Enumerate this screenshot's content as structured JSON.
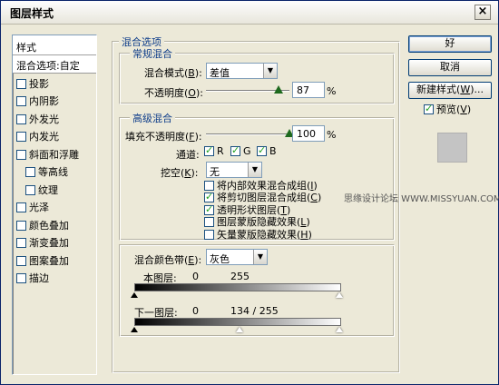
{
  "window": {
    "title": "图层样式",
    "close_label": "×"
  },
  "stylelist": {
    "header": "样式",
    "items": [
      {
        "label": "混合选项:自定",
        "checkbox": false,
        "checked": false,
        "selected": true
      },
      {
        "label": "投影",
        "checkbox": true,
        "checked": false
      },
      {
        "label": "内阴影",
        "checkbox": true,
        "checked": false
      },
      {
        "label": "外发光",
        "checkbox": true,
        "checked": false
      },
      {
        "label": "内发光",
        "checkbox": true,
        "checked": false
      },
      {
        "label": "斜面和浮雕",
        "checkbox": true,
        "checked": false
      },
      {
        "label": "等高线",
        "checkbox": true,
        "checked": false,
        "indent": true
      },
      {
        "label": "纹理",
        "checkbox": true,
        "checked": false,
        "indent": true
      },
      {
        "label": "光泽",
        "checkbox": true,
        "checked": false
      },
      {
        "label": "颜色叠加",
        "checkbox": true,
        "checked": false
      },
      {
        "label": "渐变叠加",
        "checkbox": true,
        "checked": false
      },
      {
        "label": "图案叠加",
        "checkbox": true,
        "checked": false
      },
      {
        "label": "描边",
        "checkbox": true,
        "checked": false
      }
    ]
  },
  "blending": {
    "title": "混合选项",
    "general": {
      "title": "常规混合",
      "mode_label": "混合模式(",
      "mode_key": "B",
      "mode_close": "):",
      "mode_value": "差值",
      "opacity_label": "不透明度(",
      "opacity_key": "O",
      "opacity_close": "):",
      "opacity_value": "87",
      "opacity_level": 0.87,
      "percent": "%"
    },
    "advanced": {
      "title": "高级混合",
      "fill_label": "填充不透明度(",
      "fill_key": "F",
      "fill_close": "):",
      "fill_value": "100",
      "fill_level": 1.0,
      "percent": "%",
      "channels_label": "通道:",
      "channels": [
        {
          "label": "R",
          "checked": true
        },
        {
          "label": "G",
          "checked": true
        },
        {
          "label": "B",
          "checked": true
        }
      ],
      "knockout_label": "挖空(",
      "knockout_key": "K",
      "knockout_close": "):",
      "knockout_value": "无",
      "options": [
        {
          "label": "将内部效果混合成组(",
          "key": "I",
          "close": ")",
          "checked": false
        },
        {
          "label": "将剪切图层混合成组(",
          "key": "C",
          "close": ")",
          "checked": true
        },
        {
          "label": "透明形状图层(",
          "key": "T",
          "close": ")",
          "checked": true
        },
        {
          "label": "图层蒙版隐藏效果(",
          "key": "L",
          "close": ")",
          "checked": false
        },
        {
          "label": "矢量蒙版隐藏效果(",
          "key": "H",
          "close": ")",
          "checked": false
        }
      ]
    },
    "blendif": {
      "label": "混合颜色带(",
      "key": "E",
      "close": "):",
      "value": "灰色",
      "this_layer_label": "本图层:",
      "this_layer_low": "0",
      "this_layer_high": "255",
      "under_layer_label": "下一图层:",
      "under_layer_low": "0",
      "under_layer_high": "134 / 255"
    }
  },
  "buttons": {
    "ok": "好",
    "cancel": "取消",
    "new_style": "新建样式(",
    "new_style_key": "W",
    "new_style_close": ")...",
    "preview_label": "预览(",
    "preview_key": "V",
    "preview_close": ")",
    "preview_checked": true
  },
  "watermark": "思缘设计论坛 WWW.MISSYUAN.COM"
}
